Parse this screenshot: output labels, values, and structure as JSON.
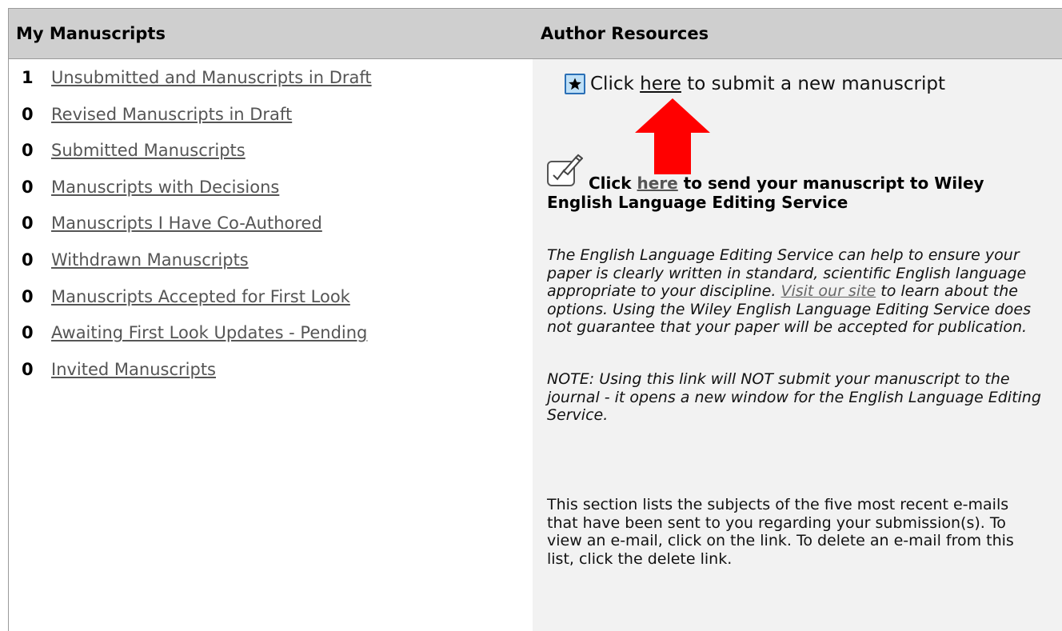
{
  "left_panel": {
    "header": "My Manuscripts",
    "items": [
      {
        "count": "1",
        "label": "Unsubmitted and Manuscripts in Draft"
      },
      {
        "count": "0",
        "label": "Revised Manuscripts in Draft"
      },
      {
        "count": "0",
        "label": "Submitted Manuscripts"
      },
      {
        "count": "0",
        "label": "Manuscripts with Decisions"
      },
      {
        "count": "0",
        "label": "Manuscripts I Have Co-Authored"
      },
      {
        "count": "0",
        "label": "Withdrawn Manuscripts"
      },
      {
        "count": "0",
        "label": "Manuscripts Accepted for First Look"
      },
      {
        "count": "0",
        "label": "Awaiting First Look Updates - Pending"
      },
      {
        "count": "0",
        "label": "Invited Manuscripts"
      }
    ]
  },
  "right_panel": {
    "header": "Author Resources",
    "submit": {
      "prefix": "Click ",
      "link": "here",
      "suffix": " to submit a new manuscript",
      "icon": "star-icon"
    },
    "wiley": {
      "prefix": "Click ",
      "link": "here",
      "suffix": " to send your manuscript to Wiley English Language Editing Service",
      "icon": "edit-check-icon"
    },
    "elis_text": {
      "before": "The English Language Editing Service can help to ensure your paper is clearly written in standard, scientific English language appropriate to your discipline. ",
      "link": "Visit our site",
      "after": " to learn about the options. Using the Wiley English Language Editing Service does not guarantee that your paper will be accepted for publication."
    },
    "note": "NOTE: Using this link will NOT submit your manuscript to the journal - it opens a new window for the English Language Editing Service.",
    "section_text": "This section lists the subjects of the five most recent e-mails that have been sent to you regarding your submission(s). To view an e-mail, click on the link. To delete an e-mail from this list, click the delete link."
  },
  "colors": {
    "header_bg": "#cfcfcf",
    "right_bg": "#f2f2f2",
    "arrow": "#ff0000",
    "star_border": "#2a6fb6"
  }
}
